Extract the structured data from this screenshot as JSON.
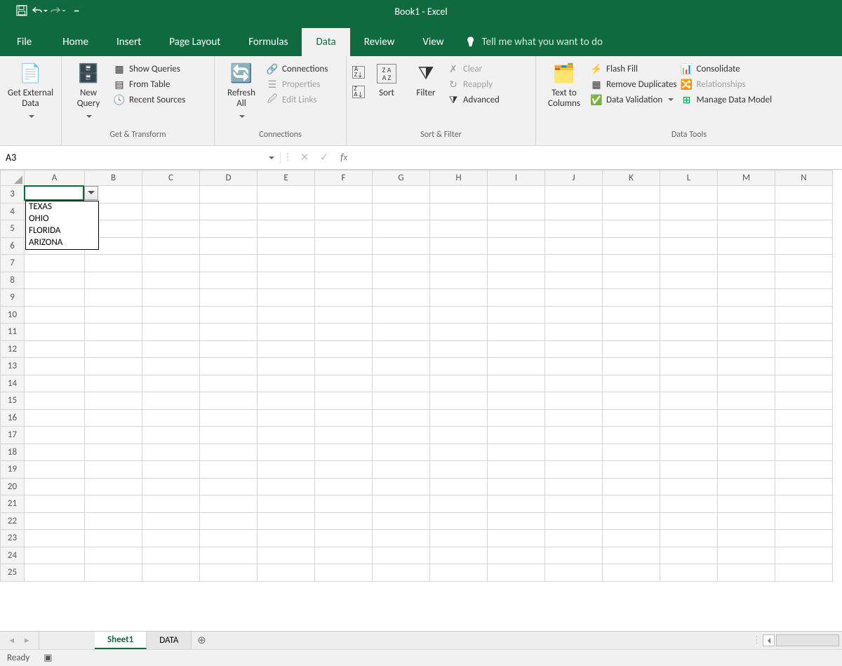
{
  "title": "Book1  -  Excel",
  "qat": {
    "save": "save-icon",
    "undo": "undo-icon",
    "redo": "redo-icon"
  },
  "tabs": {
    "file": "File",
    "home": "Home",
    "insert": "Insert",
    "page": "Page Layout",
    "formulas": "Formulas",
    "data": "Data",
    "review": "Review",
    "view": "View",
    "tellme": "Tell me what you want to do",
    "active": "data"
  },
  "ribbon": {
    "getexternal": {
      "label": "Get External\nData"
    },
    "transform": {
      "group": "Get & Transform",
      "newquery": "New\nQuery",
      "showqueries": "Show Queries",
      "fromtable": "From Table",
      "recent": "Recent Sources"
    },
    "connections": {
      "group": "Connections",
      "refresh": "Refresh\nAll",
      "conn": "Connections",
      "props": "Properties",
      "links": "Edit Links"
    },
    "sortfilter": {
      "group": "Sort & Filter",
      "sort": "Sort",
      "filter": "Filter",
      "clear": "Clear",
      "reapply": "Reapply",
      "advanced": "Advanced"
    },
    "datatools": {
      "group": "Data Tools",
      "ttc": "Text to\nColumns",
      "flash": "Flash Fill",
      "dup": "Remove Duplicates",
      "dv": "Data Validation",
      "consolidate": "Consolidate",
      "rel": "Relationships",
      "model": "Manage Data Model"
    }
  },
  "namebox": "A3",
  "formula": "",
  "columns": [
    "A",
    "B",
    "C",
    "D",
    "E",
    "F",
    "G",
    "H",
    "I",
    "J",
    "K",
    "L",
    "M",
    "N"
  ],
  "rows": [
    3,
    4,
    5,
    6,
    7,
    8,
    9,
    10,
    11,
    12,
    13,
    14,
    15,
    16,
    17,
    18,
    19,
    20,
    21,
    22,
    23,
    24,
    25
  ],
  "dropdown": [
    "TEXAS",
    "OHIO",
    "FLORIDA",
    "ARIZONA"
  ],
  "sheets": {
    "s1": "Sheet1",
    "s2": "DATA",
    "active": "s1"
  },
  "status": "Ready"
}
